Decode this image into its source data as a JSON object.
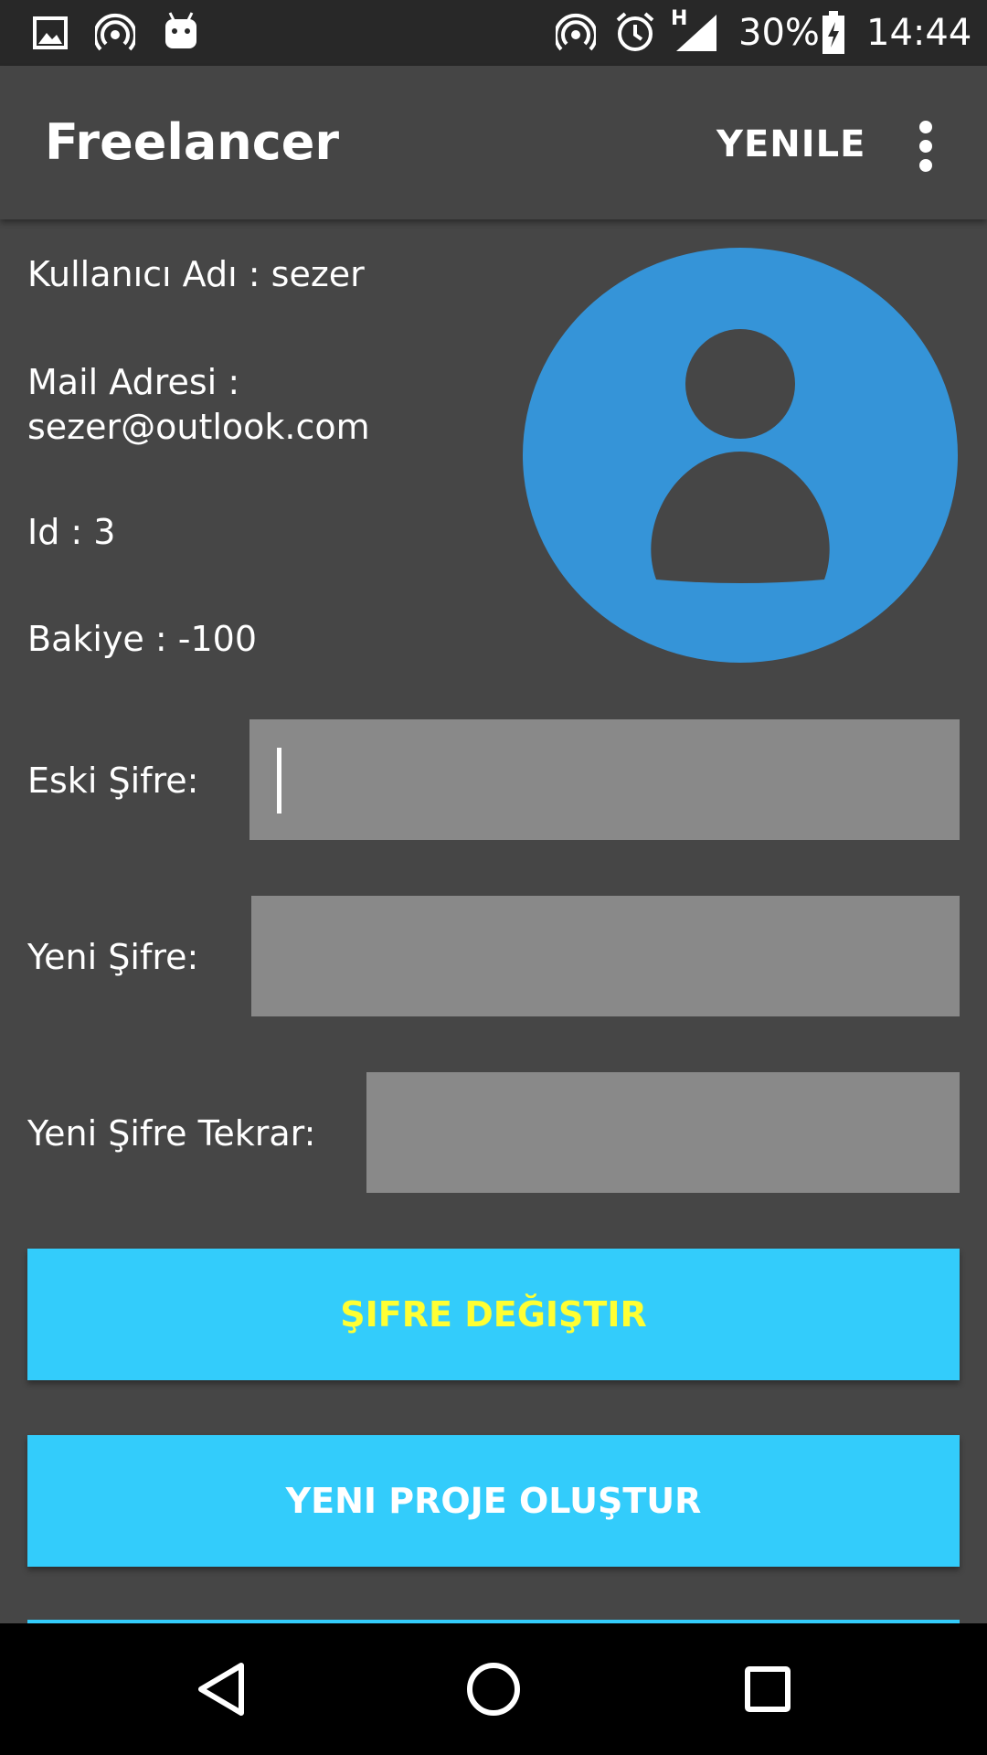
{
  "status_bar": {
    "battery": "30%",
    "time": "14:44",
    "network_type": "H",
    "icons": [
      "image-icon",
      "hotspot-icon",
      "android-icon",
      "hotspot-icon",
      "alarm-icon",
      "signal-icon",
      "battery-charging-icon"
    ]
  },
  "app_bar": {
    "title": "Freelancer",
    "refresh_label": "YENILE",
    "overflow_icon": "more-vert-icon"
  },
  "profile": {
    "username": "Kullanıcı Adı : sezer",
    "mail_label": "Mail Adresi :",
    "mail_value": "sezer@outlook.com",
    "id": "Id : 3",
    "balance": "Bakiye : -100",
    "avatar_icon": "account-circle-icon",
    "avatar_color": "#3594d8"
  },
  "password_form": {
    "old_label": "Eski Şifre:",
    "old_value": "",
    "new_label": "Yeni Şifre:",
    "new_value": "",
    "repeat_label": "Yeni Şifre Tekrar:",
    "repeat_value": ""
  },
  "actions": {
    "change_password": "ŞIFRE DEĞIŞTIR",
    "new_project": "YENI PROJE OLUŞTUR"
  },
  "colors": {
    "background": "#464646",
    "button": "#33ccfb",
    "change_text": "#ffff33"
  },
  "nav_bar": {
    "back": "back-icon",
    "home": "home-icon",
    "recents": "recents-icon"
  }
}
